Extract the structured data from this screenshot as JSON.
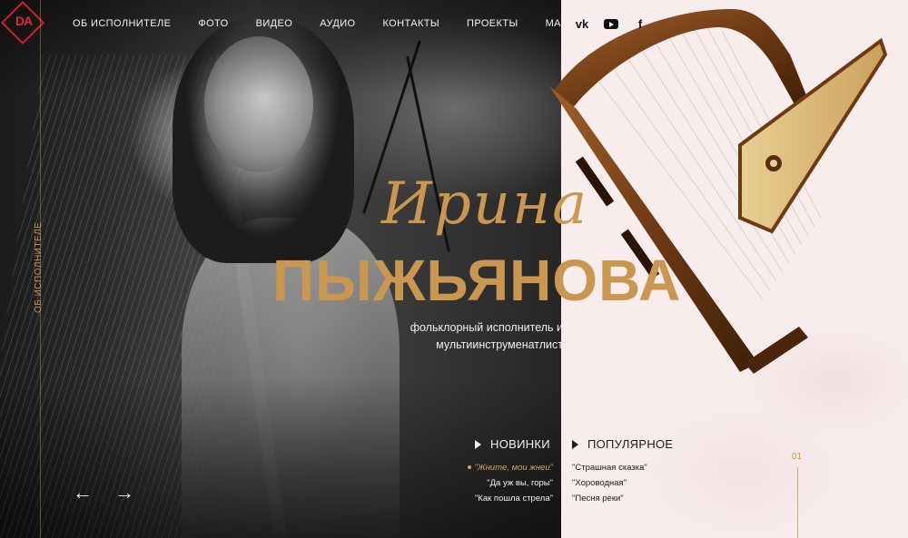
{
  "logo": {
    "text": "DA"
  },
  "nav": {
    "items": [
      {
        "label": "ОБ ИСПОЛНИТЕЛЕ"
      },
      {
        "label": "ФОТО"
      },
      {
        "label": "ВИДЕО"
      },
      {
        "label": "АУДИО"
      },
      {
        "label": "КОНТАКТЫ"
      },
      {
        "label": "ПРОЕКТЫ"
      },
      {
        "label": "МАГАЗИН"
      }
    ]
  },
  "social": {
    "vk_label": "vk",
    "youtube_icon": "youtube-icon",
    "facebook_label": "f"
  },
  "rail": {
    "label": "ОБ ИСПОЛНИТЕЛЕ"
  },
  "hero": {
    "first_name": "Ирина",
    "last_name": "ПЫЖЬЯНОВА",
    "subtitle_line1": "фольклорный исполнитель и",
    "subtitle_line2": "мультиинструменатлист"
  },
  "slider": {
    "prev": "←",
    "next": "→",
    "counter": "01"
  },
  "new_songs": {
    "heading": "НОВИНКИ",
    "items": [
      "\"Жните, мои жнеи\"",
      "\"Да уж вы, горы\"",
      "\"Как пошла стрела\""
    ]
  },
  "popular_songs": {
    "heading": "ПОПУЛЯРНОЕ",
    "items": [
      "\"Страшная сказка\"",
      "\"Хороводная\"",
      "\"Песня реки\""
    ]
  },
  "colors": {
    "accent": "#c9974f",
    "logo_red": "#d61f2a",
    "pink_bg": "#f8ecec"
  }
}
